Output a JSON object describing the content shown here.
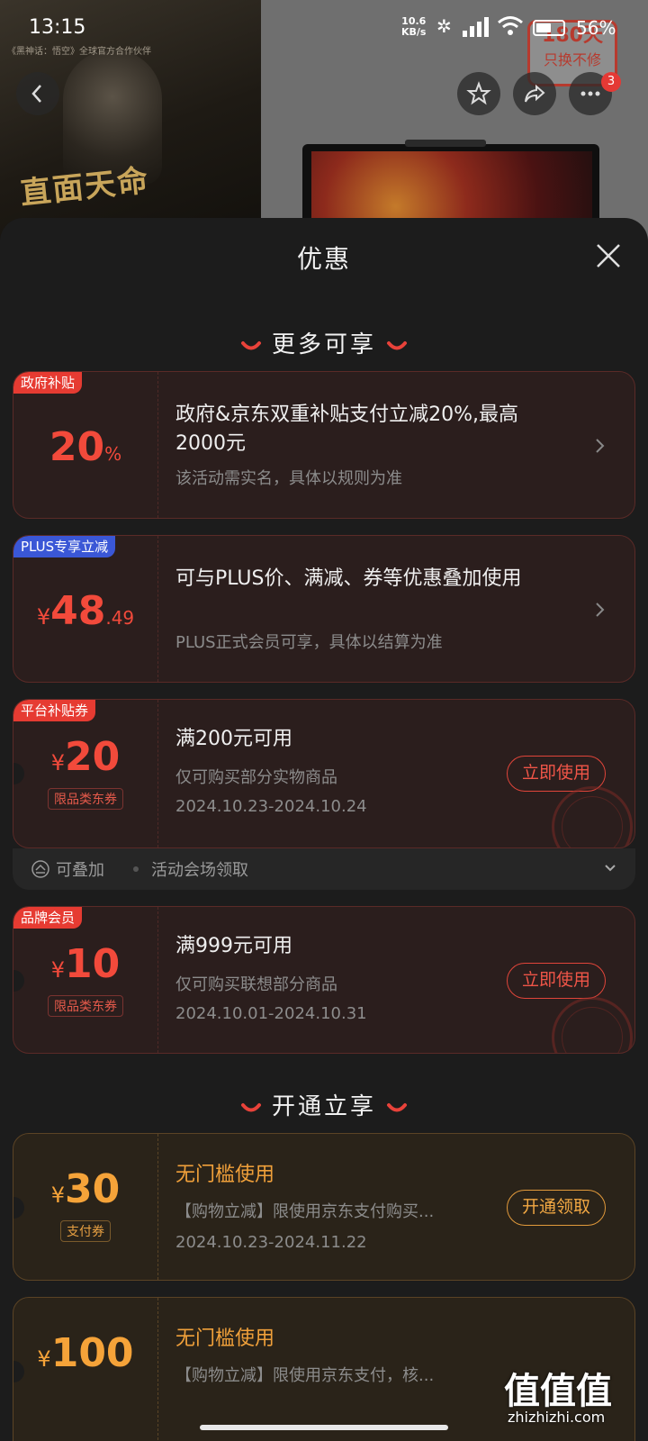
{
  "status_bar": {
    "time": "13:15",
    "net_speed_value": "10.6",
    "net_speed_unit": "KB/s",
    "battery_percent": "56%",
    "battery_level": 0.56
  },
  "background": {
    "game_caption": "《黑神话：悟空》全球官方合作伙伴",
    "game_slogan": "直面天命",
    "badge_top": "180天",
    "badge_bottom": "只换不修",
    "notification_count": "3"
  },
  "sheet": {
    "title": "优惠",
    "section_more": "更多可享",
    "section_open": "开通立享"
  },
  "cards": {
    "gov": {
      "tag": "政府补贴",
      "amount": "20",
      "amount_suffix": "%",
      "title": "政府&京东双重补贴支付立减20%,最高2000元",
      "subtitle": "该活动需实名，具体以规则为准"
    },
    "plus": {
      "tag": "PLUS专享立减",
      "currency": "¥",
      "amount_int": "48",
      "amount_dec": ".49",
      "title": "可与PLUS价、满减、券等优惠叠加使用",
      "subtitle": "PLUS正式会员可享，具体以结算为准"
    },
    "platform": {
      "tag": "平台补贴券",
      "currency": "¥",
      "amount": "20",
      "chip": "限品类东券",
      "title": "满200元可用",
      "subtitle": "仅可购买部分实物商品",
      "date": "2024.10.23-2024.10.24",
      "button": "立即使用",
      "stackable": "可叠加",
      "source": "活动会场领取"
    },
    "brand": {
      "tag": "品牌会员",
      "currency": "¥",
      "amount": "10",
      "chip": "限品类东券",
      "title": "满999元可用",
      "subtitle": "仅可购买联想部分商品",
      "date": "2024.10.01-2024.10.31",
      "button": "立即使用"
    },
    "pay30": {
      "currency": "¥",
      "amount": "30",
      "chip": "支付券",
      "title": "无门槛使用",
      "subtitle": "【购物立减】限使用京东支付购买...",
      "date": "2024.10.23-2024.11.22",
      "button": "开通领取"
    },
    "pay100": {
      "currency": "¥",
      "amount": "100",
      "title": "无门槛使用",
      "subtitle": "【购物立减】限使用京东支付，核..."
    }
  },
  "watermark": {
    "text": "值值值",
    "url": "zhizhizhi.com"
  },
  "colors": {
    "accent_red": "#f24a3b",
    "accent_gold": "#f5a339",
    "tag_blue": "#3a57d6",
    "sheet_bg": "#1c1c1c"
  }
}
